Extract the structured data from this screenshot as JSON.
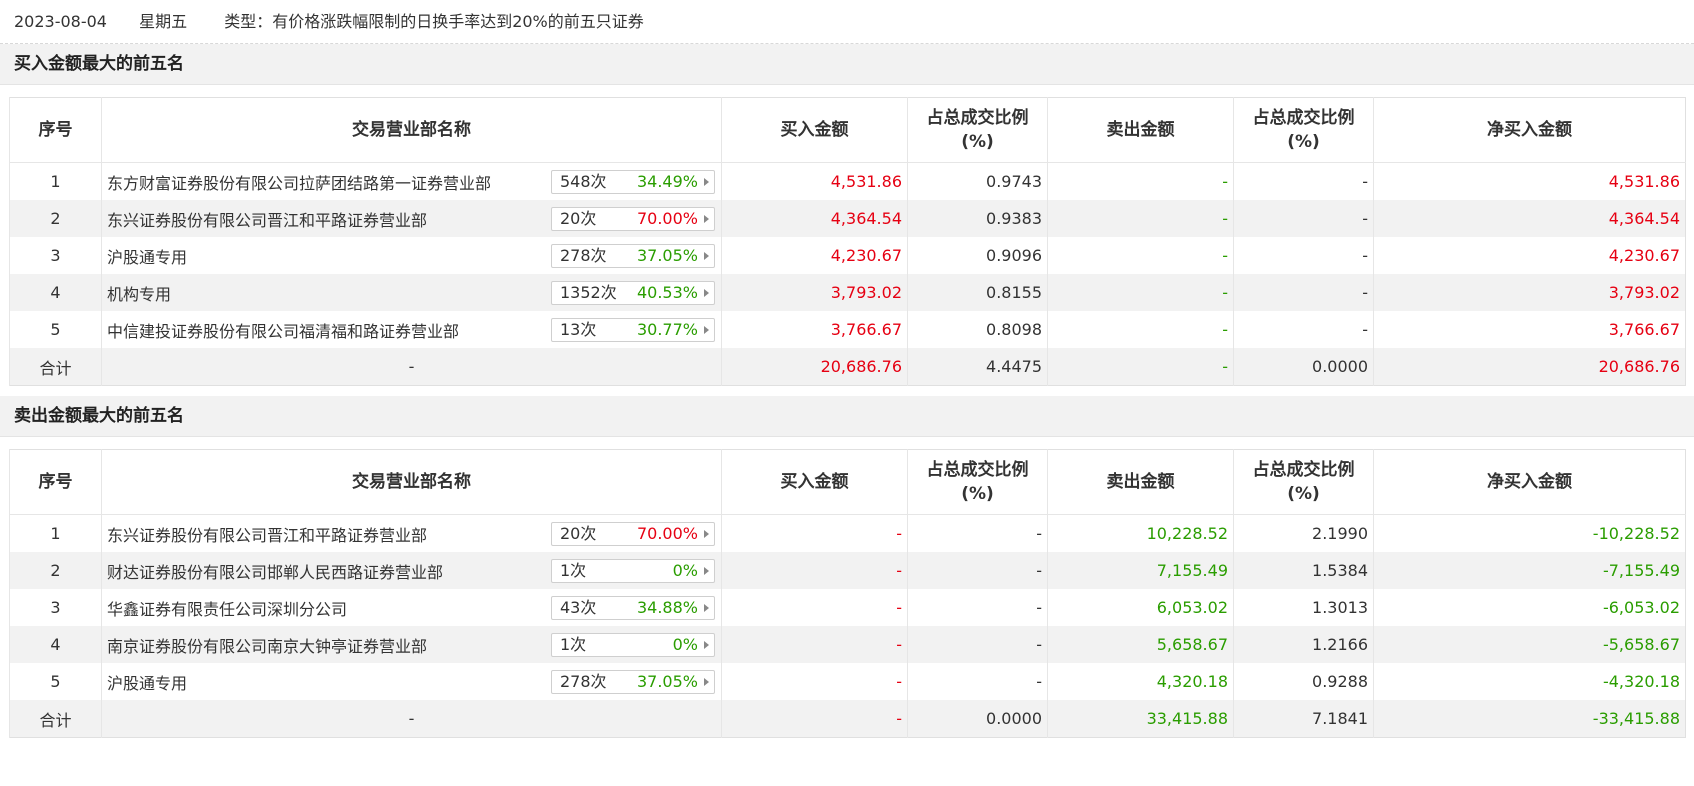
{
  "header": {
    "date": "2023-08-04",
    "weekday": "星期五",
    "type_text": "类型：有价格涨跌幅限制的日换手率达到20%的前五只证券"
  },
  "colors": {
    "up": "#e60012",
    "down": "#2a9d00"
  },
  "columns": {
    "seq": "序号",
    "dept": "交易营业部名称",
    "buy": "买入金额",
    "ratio_a": "占总成交比例",
    "ratio_b": "(%)",
    "sell": "卖出金额",
    "net": "净买入金额"
  },
  "buy_section": {
    "title": "买入金额最大的前五名",
    "rows": [
      {
        "seq": "1",
        "name": "东方财富证券股份有限公司拉萨团结路第一证券营业部",
        "times": "548次",
        "pct": "34.49%",
        "pct_color": "green",
        "buy": "4,531.86",
        "buy_ratio": "0.9743",
        "sell": "-",
        "sell_ratio": "-",
        "net": "4,531.86"
      },
      {
        "seq": "2",
        "name": "东兴证券股份有限公司晋江和平路证券营业部",
        "times": "20次",
        "pct": "70.00%",
        "pct_color": "red",
        "buy": "4,364.54",
        "buy_ratio": "0.9383",
        "sell": "-",
        "sell_ratio": "-",
        "net": "4,364.54"
      },
      {
        "seq": "3",
        "name": "沪股通专用",
        "times": "278次",
        "pct": "37.05%",
        "pct_color": "green",
        "buy": "4,230.67",
        "buy_ratio": "0.9096",
        "sell": "-",
        "sell_ratio": "-",
        "net": "4,230.67"
      },
      {
        "seq": "4",
        "name": "机构专用",
        "times": "1352次",
        "pct": "40.53%",
        "pct_color": "green",
        "buy": "3,793.02",
        "buy_ratio": "0.8155",
        "sell": "-",
        "sell_ratio": "-",
        "net": "3,793.02"
      },
      {
        "seq": "5",
        "name": "中信建投证券股份有限公司福清福和路证券营业部",
        "times": "13次",
        "pct": "30.77%",
        "pct_color": "green",
        "buy": "3,766.67",
        "buy_ratio": "0.8098",
        "sell": "-",
        "sell_ratio": "-",
        "net": "3,766.67"
      }
    ],
    "total": {
      "label": "合计",
      "name": "-",
      "buy": "20,686.76",
      "buy_ratio": "4.4475",
      "sell": "-",
      "sell_ratio": "0.0000",
      "net": "20,686.76"
    }
  },
  "sell_section": {
    "title": "卖出金额最大的前五名",
    "rows": [
      {
        "seq": "1",
        "name": "东兴证券股份有限公司晋江和平路证券营业部",
        "times": "20次",
        "pct": "70.00%",
        "pct_color": "red",
        "buy": "-",
        "buy_ratio": "-",
        "sell": "10,228.52",
        "sell_ratio": "2.1990",
        "net": "-10,228.52"
      },
      {
        "seq": "2",
        "name": "财达证券股份有限公司邯郸人民西路证券营业部",
        "times": "1次",
        "pct": "0%",
        "pct_color": "green",
        "buy": "-",
        "buy_ratio": "-",
        "sell": "7,155.49",
        "sell_ratio": "1.5384",
        "net": "-7,155.49"
      },
      {
        "seq": "3",
        "name": "华鑫证券有限责任公司深圳分公司",
        "times": "43次",
        "pct": "34.88%",
        "pct_color": "green",
        "buy": "-",
        "buy_ratio": "-",
        "sell": "6,053.02",
        "sell_ratio": "1.3013",
        "net": "-6,053.02"
      },
      {
        "seq": "4",
        "name": "南京证券股份有限公司南京大钟亭证券营业部",
        "times": "1次",
        "pct": "0%",
        "pct_color": "green",
        "buy": "-",
        "buy_ratio": "-",
        "sell": "5,658.67",
        "sell_ratio": "1.2166",
        "net": "-5,658.67"
      },
      {
        "seq": "5",
        "name": "沪股通专用",
        "times": "278次",
        "pct": "37.05%",
        "pct_color": "green",
        "buy": "-",
        "buy_ratio": "-",
        "sell": "4,320.18",
        "sell_ratio": "0.9288",
        "net": "-4,320.18"
      }
    ],
    "total": {
      "label": "合计",
      "name": "-",
      "buy": "-",
      "buy_ratio": "0.0000",
      "sell": "33,415.88",
      "sell_ratio": "7.1841",
      "net": "-33,415.88"
    }
  }
}
